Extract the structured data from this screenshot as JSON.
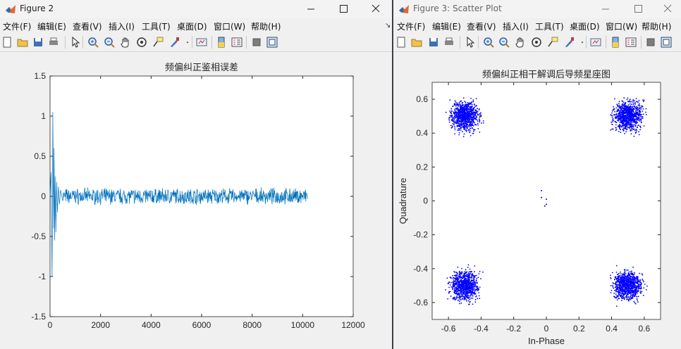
{
  "figure2": {
    "title": "Figure 2",
    "menu": [
      "文件(F)",
      "编辑(E)",
      "查看(V)",
      "插入(I)",
      "工具(T)",
      "桌面(D)",
      "窗口(W)",
      "帮助(H)"
    ],
    "dock_arrow": "↘"
  },
  "figure3": {
    "title": "Figure 3: Scatter Plot",
    "menu": [
      "文件(F)",
      "编辑(E)",
      "查看(V)",
      "插入(I)",
      "工具(T)",
      "桌面(D)",
      "窗口(W)",
      "帮助(H)"
    ]
  },
  "toolbar_icons": [
    "new-figure-icon",
    "open-file-icon",
    "save-icon",
    "print-icon",
    "pointer-icon",
    "zoom-in-icon",
    "zoom-out-icon",
    "pan-icon",
    "rotate-3d-icon",
    "data-cursor-icon",
    "brush-icon",
    "brush-dropdown-icon",
    "link-plot-icon",
    "insert-colorbar-icon",
    "insert-legend-icon",
    "hide-plot-tools-icon",
    "show-plot-tools-icon"
  ],
  "colors": {
    "line": "#0072bd",
    "scatter": "#0000ff"
  },
  "chart_data": [
    {
      "type": "line",
      "title": "频偏纠正鉴相误差",
      "xlabel": "",
      "ylabel": "",
      "xlim": [
        0,
        12000
      ],
      "ylim": [
        -1.5,
        1.5
      ],
      "xticks": [
        0,
        2000,
        4000,
        6000,
        8000,
        10000,
        12000
      ],
      "yticks": [
        -1.5,
        -1,
        -0.5,
        0,
        0.5,
        1,
        1.5
      ],
      "xtick_labels": [
        "0",
        "2000",
        "4000",
        "6000",
        "8000",
        "10000",
        "12000"
      ],
      "ytick_labels": [
        "-1.5",
        "-1",
        "-0.5",
        "0",
        "0.5",
        "1",
        "1.5"
      ],
      "grid": false,
      "series": [
        {
          "x": [
            0,
            40,
            80,
            110,
            140,
            160,
            180,
            200,
            230,
            260,
            290,
            330,
            370,
            420,
            500,
            10200
          ],
          "y": [
            0,
            0.3,
            -1.0,
            1.05,
            -0.4,
            0.6,
            -0.55,
            0.25,
            -0.45,
            0.18,
            -0.2,
            0.12,
            -0.1,
            0.08,
            0.0,
            0.0
          ],
          "noise_band": 0.08
        }
      ]
    },
    {
      "type": "scatter",
      "title": "频偏纠正相干解调后导频星座图",
      "xlabel": "In-Phase",
      "ylabel": "Quadrature",
      "xlim": [
        -0.7,
        0.7
      ],
      "ylim": [
        -0.7,
        0.7
      ],
      "xticks": [
        -0.6,
        -0.4,
        -0.2,
        0,
        0.2,
        0.4,
        0.6
      ],
      "yticks": [
        -0.6,
        -0.4,
        -0.2,
        0,
        0.2,
        0.4,
        0.6
      ],
      "xtick_labels": [
        "-0.6",
        "-0.4",
        "-0.2",
        "0",
        "0.2",
        "0.4",
        "0.6"
      ],
      "ytick_labels": [
        "-0.6",
        "-0.4",
        "-0.2",
        "0",
        "0.2",
        "0.4",
        "0.6"
      ],
      "grid": false,
      "clusters": [
        {
          "center": [
            -0.5,
            0.5
          ],
          "spread": 0.04
        },
        {
          "center": [
            0.5,
            0.5
          ],
          "spread": 0.04
        },
        {
          "center": [
            -0.5,
            -0.5
          ],
          "spread": 0.04
        },
        {
          "center": [
            0.5,
            -0.5
          ],
          "spread": 0.04
        }
      ],
      "outliers": [
        [
          -0.03,
          0.06
        ],
        [
          -0.03,
          0.02
        ],
        [
          0.0,
          0.01
        ],
        [
          -0.01,
          -0.03
        ],
        [
          0.0,
          -0.02
        ]
      ]
    }
  ]
}
